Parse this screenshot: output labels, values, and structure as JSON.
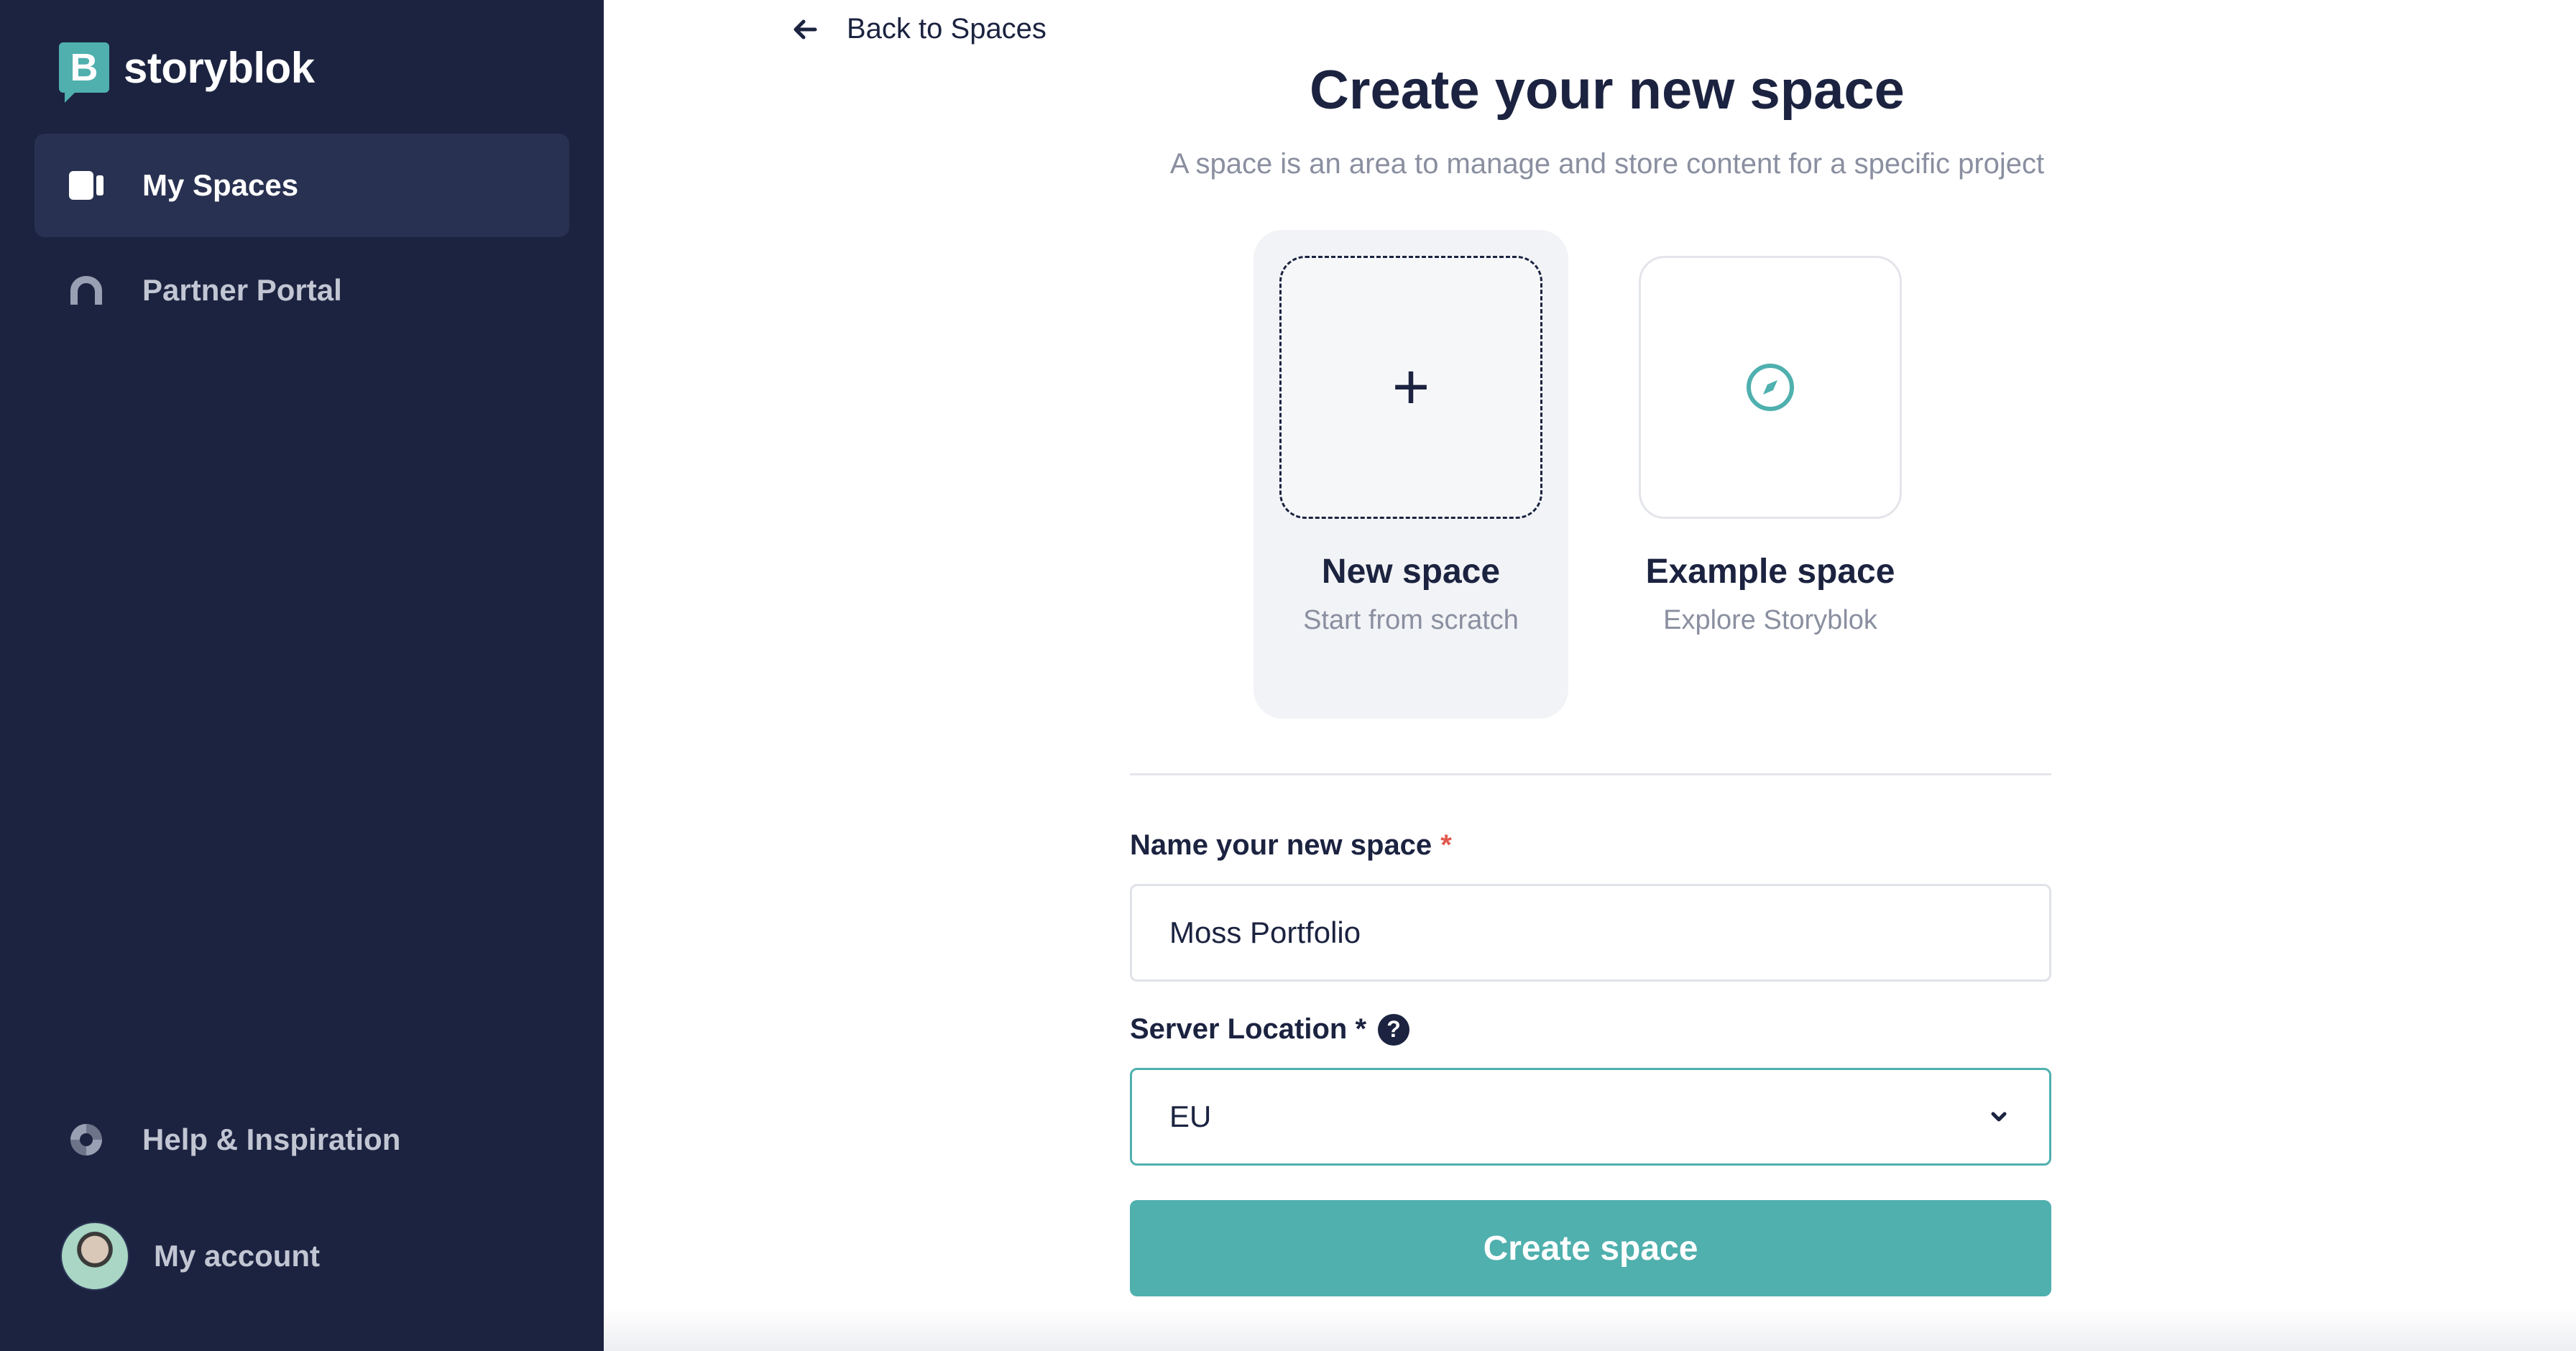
{
  "brand": {
    "name": "storyblok",
    "mark": "B"
  },
  "sidebar": {
    "items": [
      {
        "label": "My Spaces",
        "icon": "spaces-icon",
        "active": true
      },
      {
        "label": "Partner Portal",
        "icon": "partner-portal-icon",
        "active": false
      },
      {
        "label": "Help & Inspiration",
        "icon": "lifebuoy-icon",
        "active": false
      }
    ],
    "account": {
      "label": "My account",
      "icon": "avatar"
    }
  },
  "main": {
    "back_label": "Back to Spaces",
    "title": "Create your new space",
    "subtitle": "A space is an area to manage and store content for a specific project",
    "options": [
      {
        "title": "New space",
        "subtitle": "Start from scratch",
        "icon": "plus-icon",
        "selected": true
      },
      {
        "title": "Example space",
        "subtitle": "Explore Storyblok",
        "icon": "compass-icon",
        "selected": false
      }
    ],
    "form": {
      "name_label": "Name your new space",
      "name_required": "*",
      "name_value": "Moss Portfolio",
      "location_label": "Server Location *",
      "location_help": "?",
      "location_value": "EU",
      "submit_label": "Create space"
    }
  },
  "colors": {
    "sidebar_bg": "#1b2340",
    "accent": "#4fb0ae",
    "required": "#e2574c"
  }
}
